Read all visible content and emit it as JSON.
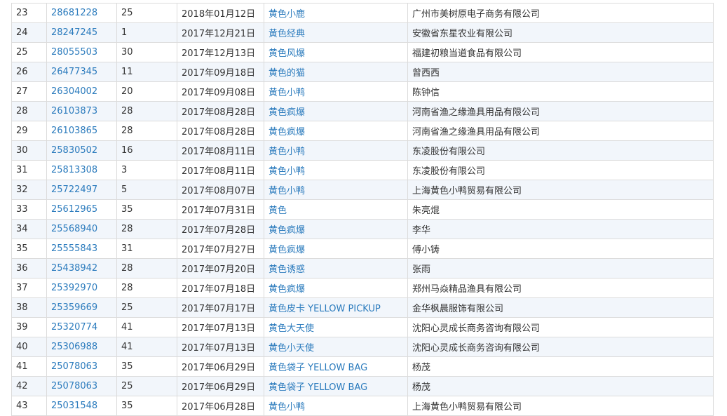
{
  "rows": [
    {
      "idx": "23",
      "reg": "28681228",
      "cls": "25",
      "date": "2018年01月12日",
      "name": "黄色小鹿",
      "applicant": "广州市美树原电子商务有限公司"
    },
    {
      "idx": "24",
      "reg": "28247245",
      "cls": "1",
      "date": "2017年12月21日",
      "name": "黄色经典",
      "applicant": "安徽省东星农业有限公司"
    },
    {
      "idx": "25",
      "reg": "28055503",
      "cls": "30",
      "date": "2017年12月13日",
      "name": "黄色风爆",
      "applicant": "福建初粮当道食品有限公司"
    },
    {
      "idx": "26",
      "reg": "26477345",
      "cls": "11",
      "date": "2017年09月18日",
      "name": "黄色的猫",
      "applicant": "曾西西"
    },
    {
      "idx": "27",
      "reg": "26304002",
      "cls": "20",
      "date": "2017年09月08日",
      "name": "黄色小鸭",
      "applicant": "陈钟信"
    },
    {
      "idx": "28",
      "reg": "26103873",
      "cls": "28",
      "date": "2017年08月28日",
      "name": "黄色疯爆",
      "applicant": "河南省渔之缘渔具用品有限公司"
    },
    {
      "idx": "29",
      "reg": "26103865",
      "cls": "28",
      "date": "2017年08月28日",
      "name": "黄色疯爆",
      "applicant": "河南省渔之缘渔具用品有限公司"
    },
    {
      "idx": "30",
      "reg": "25830502",
      "cls": "16",
      "date": "2017年08月11日",
      "name": "黄色小鸭",
      "applicant": "东凌股份有限公司"
    },
    {
      "idx": "31",
      "reg": "25813308",
      "cls": "3",
      "date": "2017年08月11日",
      "name": "黄色小鸭",
      "applicant": "东凌股份有限公司"
    },
    {
      "idx": "32",
      "reg": "25722497",
      "cls": "5",
      "date": "2017年08月07日",
      "name": "黄色小鸭",
      "applicant": "上海黄色小鸭贸易有限公司"
    },
    {
      "idx": "33",
      "reg": "25612965",
      "cls": "35",
      "date": "2017年07月31日",
      "name": "黄色",
      "applicant": "朱亮焜"
    },
    {
      "idx": "34",
      "reg": "25568940",
      "cls": "28",
      "date": "2017年07月28日",
      "name": "黄色疯爆",
      "applicant": "李华"
    },
    {
      "idx": "35",
      "reg": "25555843",
      "cls": "31",
      "date": "2017年07月27日",
      "name": "黄色疯爆",
      "applicant": "傅小铸"
    },
    {
      "idx": "36",
      "reg": "25438942",
      "cls": "28",
      "date": "2017年07月20日",
      "name": "黄色诱惑",
      "applicant": "张雨"
    },
    {
      "idx": "37",
      "reg": "25392970",
      "cls": "28",
      "date": "2017年07月18日",
      "name": "黄色疯爆",
      "applicant": "郑州马焱精品渔具有限公司"
    },
    {
      "idx": "38",
      "reg": "25359669",
      "cls": "25",
      "date": "2017年07月17日",
      "name": "黄色皮卡 YELLOW PICKUP",
      "applicant": "金华枫晨服饰有限公司"
    },
    {
      "idx": "39",
      "reg": "25320774",
      "cls": "41",
      "date": "2017年07月13日",
      "name": "黄色大天使",
      "applicant": "沈阳心灵成长商务咨询有限公司"
    },
    {
      "idx": "40",
      "reg": "25306988",
      "cls": "41",
      "date": "2017年07月13日",
      "name": "黄色小天使",
      "applicant": "沈阳心灵成长商务咨询有限公司"
    },
    {
      "idx": "41",
      "reg": "25078063",
      "cls": "35",
      "date": "2017年06月29日",
      "name": "黄色袋子 YELLOW BAG",
      "applicant": "杨茂"
    },
    {
      "idx": "42",
      "reg": "25078063",
      "cls": "25",
      "date": "2017年06月29日",
      "name": "黄色袋子 YELLOW BAG",
      "applicant": "杨茂"
    },
    {
      "idx": "43",
      "reg": "25031548",
      "cls": "35",
      "date": "2017年06月28日",
      "name": "黄色小鸭",
      "applicant": "上海黄色小鸭贸易有限公司"
    }
  ],
  "colors": {
    "link": "#2b7bbd",
    "text": "#333333",
    "row_alt": "#f2f6fb",
    "border": "#dcdcdc"
  }
}
